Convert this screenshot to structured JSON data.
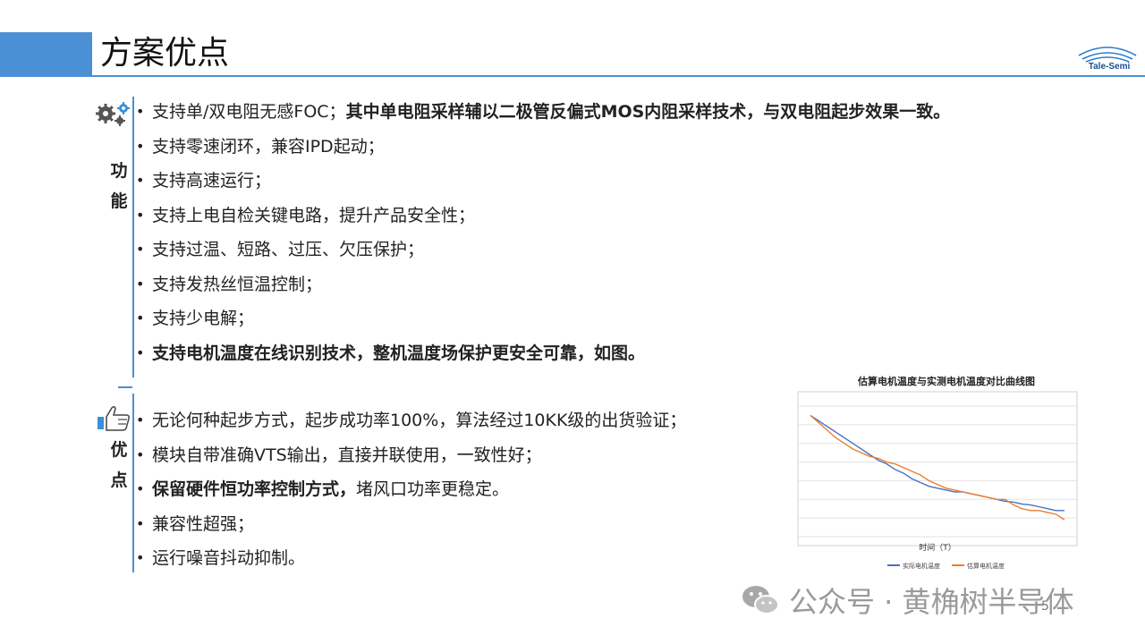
{
  "title": "方案优点",
  "logo_text": "Tale-Semi",
  "sections": {
    "function": {
      "label_chars": [
        "功",
        "能"
      ],
      "items": [
        {
          "plain": "支持单/双电阻无感FOC；",
          "bold": "其中单电阻采样辅以二极管反偏式MOS内阻采样技术，与双电阻起步效果一致。"
        },
        {
          "plain": "支持零速闭环，兼容IPD起动；",
          "bold": ""
        },
        {
          "plain": "支持高速运行；",
          "bold": ""
        },
        {
          "plain": "支持上电自检关键电路，提升产品安全性；",
          "bold": ""
        },
        {
          "plain": "支持过温、短路、过压、欠压保护；",
          "bold": ""
        },
        {
          "plain": "支持发热丝恒温控制；",
          "bold": ""
        },
        {
          "plain": "支持少电解；",
          "bold": ""
        },
        {
          "plain": "",
          "bold": "支持电机温度在线识别技术，整机温度场保护更安全可靠，如图。"
        }
      ]
    },
    "advantage": {
      "label_chars": [
        "优",
        "点"
      ],
      "items": [
        {
          "bold": "",
          "plain": "无论何种起步方式，起步成功率100%，算法经过10KK级的出货验证；"
        },
        {
          "bold": "",
          "plain": "模块自带准确VTS输出，直接并联使用，一致性好；"
        },
        {
          "bold": "保留硬件恒功率控制方式，",
          "plain": "堵风口功率更稳定。"
        },
        {
          "bold": "",
          "plain": "兼容性超强；"
        },
        {
          "bold": "",
          "plain": "运行噪音抖动抑制。"
        }
      ]
    }
  },
  "bullet_char": "•",
  "chart_data": {
    "type": "line",
    "title": "估算电机温度与实测电机温度对比曲线图",
    "xlabel": "时间（T）",
    "ylabel": "",
    "x": [
      0,
      1,
      2,
      3,
      4,
      5,
      6,
      7,
      8,
      9,
      10,
      11,
      12,
      13,
      14,
      15,
      16,
      17,
      18,
      19,
      20,
      21,
      22,
      23,
      24,
      25,
      26,
      27,
      28,
      29,
      30
    ],
    "ylim": [
      0,
      7
    ],
    "grid": true,
    "legend_position": "bottom",
    "series": [
      {
        "name": "实际电机温度",
        "color": "#4472c4",
        "values": [
          6.5,
          6.2,
          5.9,
          5.6,
          5.3,
          5.0,
          4.7,
          4.4,
          4.1,
          3.9,
          3.6,
          3.4,
          3.1,
          2.9,
          2.7,
          2.6,
          2.5,
          2.4,
          2.4,
          2.3,
          2.2,
          2.1,
          2.0,
          1.9,
          1.85,
          1.75,
          1.7,
          1.6,
          1.5,
          1.4,
          1.4
        ]
      },
      {
        "name": "估算电机温度",
        "color": "#ed7d31",
        "values": [
          6.5,
          6.1,
          5.7,
          5.3,
          5.0,
          4.7,
          4.5,
          4.3,
          4.2,
          4.0,
          3.9,
          3.7,
          3.5,
          3.3,
          3.0,
          2.8,
          2.6,
          2.5,
          2.4,
          2.3,
          2.2,
          2.1,
          2.0,
          2.0,
          1.7,
          1.5,
          1.4,
          1.4,
          1.3,
          1.2,
          0.9
        ]
      }
    ]
  },
  "page_number": "5",
  "watermark": "公众号 · 黄桷树半导体"
}
